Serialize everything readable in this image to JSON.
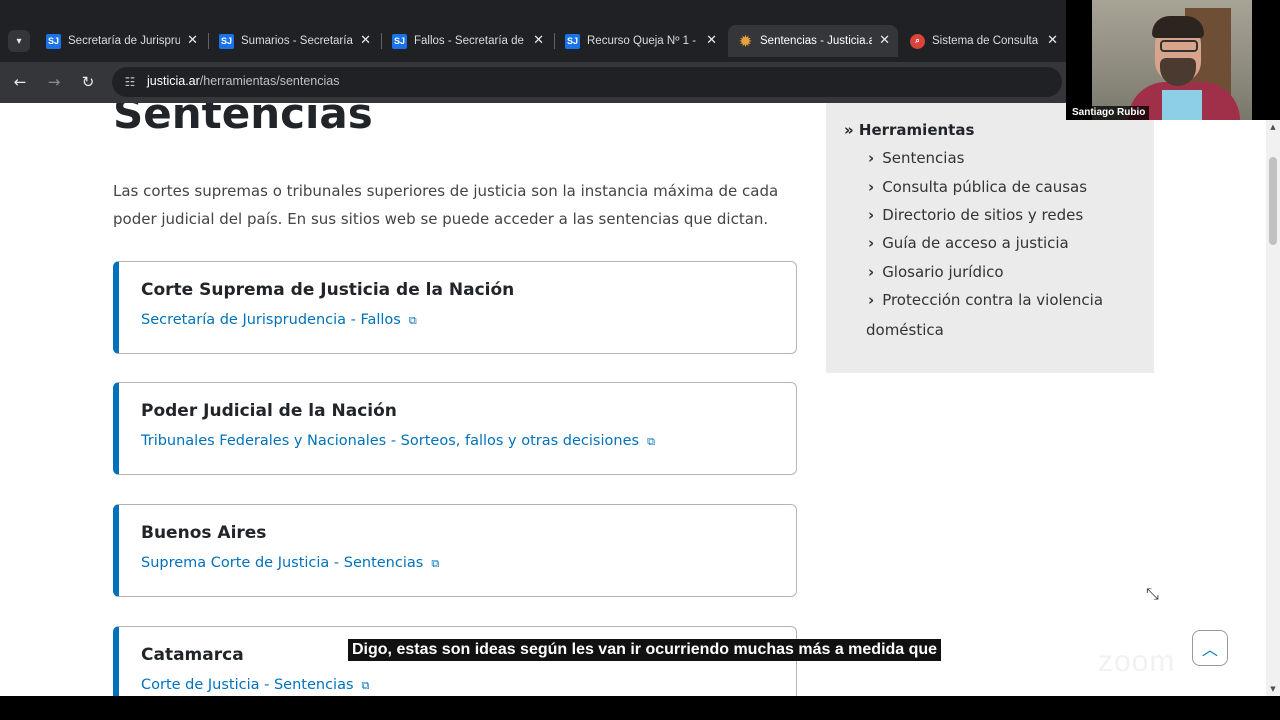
{
  "browser": {
    "tabs": [
      {
        "favicon": "SJ",
        "title": "Secretaría de Jurisprudencia",
        "active": false
      },
      {
        "favicon": "SJ",
        "title": "Sumarios - Secretaría",
        "active": false
      },
      {
        "favicon": "SJ",
        "title": "Fallos - Secretaría de",
        "active": false
      },
      {
        "favicon": "SJ",
        "title": "Recurso Queja Nº 1 -",
        "active": false
      },
      {
        "favicon": "sun",
        "title": "Sentencias - Justicia.ar",
        "active": true
      },
      {
        "favicon": "pdf",
        "title": "Sistema de Consultas",
        "active": false
      }
    ],
    "url_host": "justicia.ar",
    "url_path": "/herramientas/sentencias"
  },
  "page": {
    "heading": "Sentencias",
    "intro": "Las cortes supremas o tribunales superiores de justicia son la instancia máxima de cada poder judicial del país. En sus sitios web se puede acceder a las sentencias que dictan.",
    "cards": [
      {
        "title": "Corte Suprema de Justicia de la Nación",
        "link": "Secretaría de Jurisprudencia - Fallos"
      },
      {
        "title": "Poder Judicial de la Nación",
        "link": "Tribunales Federales y Nacionales - Sorteos, fallos y otras decisiones"
      },
      {
        "title": "Buenos Aires",
        "link": "Suprema Corte de Justicia - Sentencias"
      },
      {
        "title": "Catamarca",
        "link": "Corte de Justicia - Sentencias"
      }
    ],
    "sidebar": {
      "title": "» Herramientas",
      "items": [
        "Sentencias",
        "Consulta pública de causas",
        "Directorio de sitios y redes",
        "Guía de acceso a justicia",
        "Glosario jurídico",
        "Protección contra la violencia"
      ],
      "item_cont": "doméstica"
    }
  },
  "zoom": {
    "participant_name": "Santiago Rubio",
    "caption": "Digo, estas son ideas según les van ir ocurriendo muchas más a medida que",
    "watermark": "zoom"
  },
  "colors": {
    "accent": "#0072bb",
    "sidebar_bg": "#ebebeb",
    "chrome_dark": "#202124"
  }
}
